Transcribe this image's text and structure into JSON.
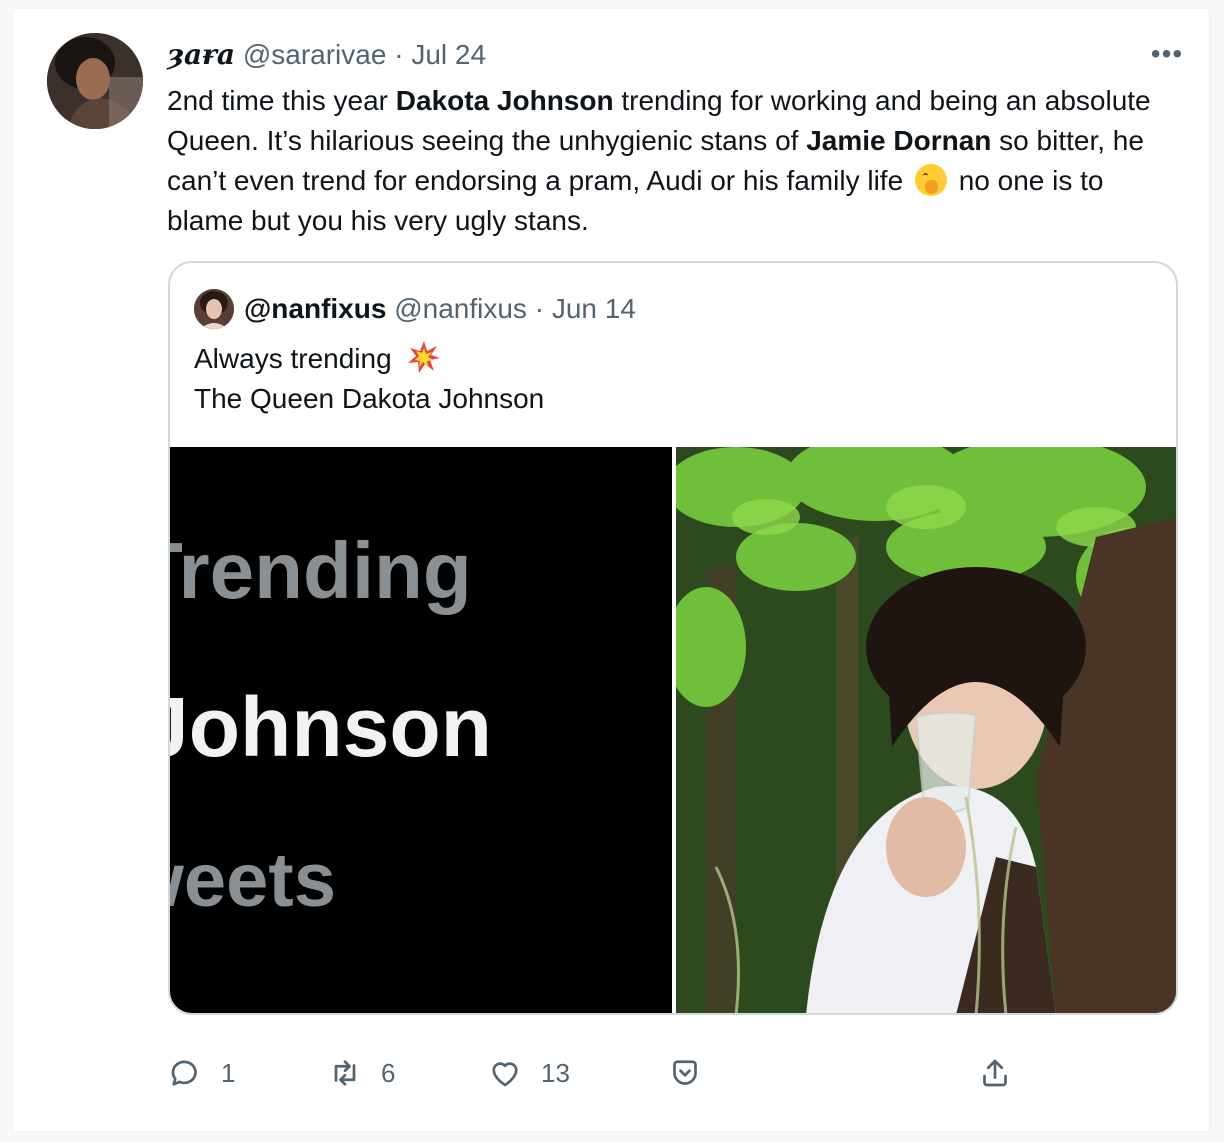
{
  "tweet": {
    "display_name": "ȝaɍa",
    "handle": "@sararivae",
    "separator": "·",
    "date": "Jul 24",
    "more_label": "•••",
    "text": {
      "p1": "2nd time this year ",
      "b1": "Dakota Johnson",
      "p2": " trending for working and being an absolute Queen.  It’s hilarious seeing the unhygienic stans of ",
      "b2": "Jamie Dornan",
      "p3": " so bitter, he can’t even trend for endorsing a pram, Audi or his family life ",
      "p4": " no one is to blame but you his very ugly stans."
    }
  },
  "quote": {
    "display_name": "@nanfixus",
    "handle": "@nanfixus",
    "separator": "·",
    "date": "Jun 14",
    "line1": "Always trending",
    "line2": "The Queen Dakota Johnson",
    "media_left_text": {
      "word1": "Trending",
      "word2": "Johnson",
      "word3": "Tweets"
    }
  },
  "actions": {
    "reply_count": "1",
    "retweet_count": "6",
    "like_count": "13"
  },
  "colors": {
    "muted": "#536471",
    "border": "#cfd9de",
    "text": "#0f1419"
  }
}
